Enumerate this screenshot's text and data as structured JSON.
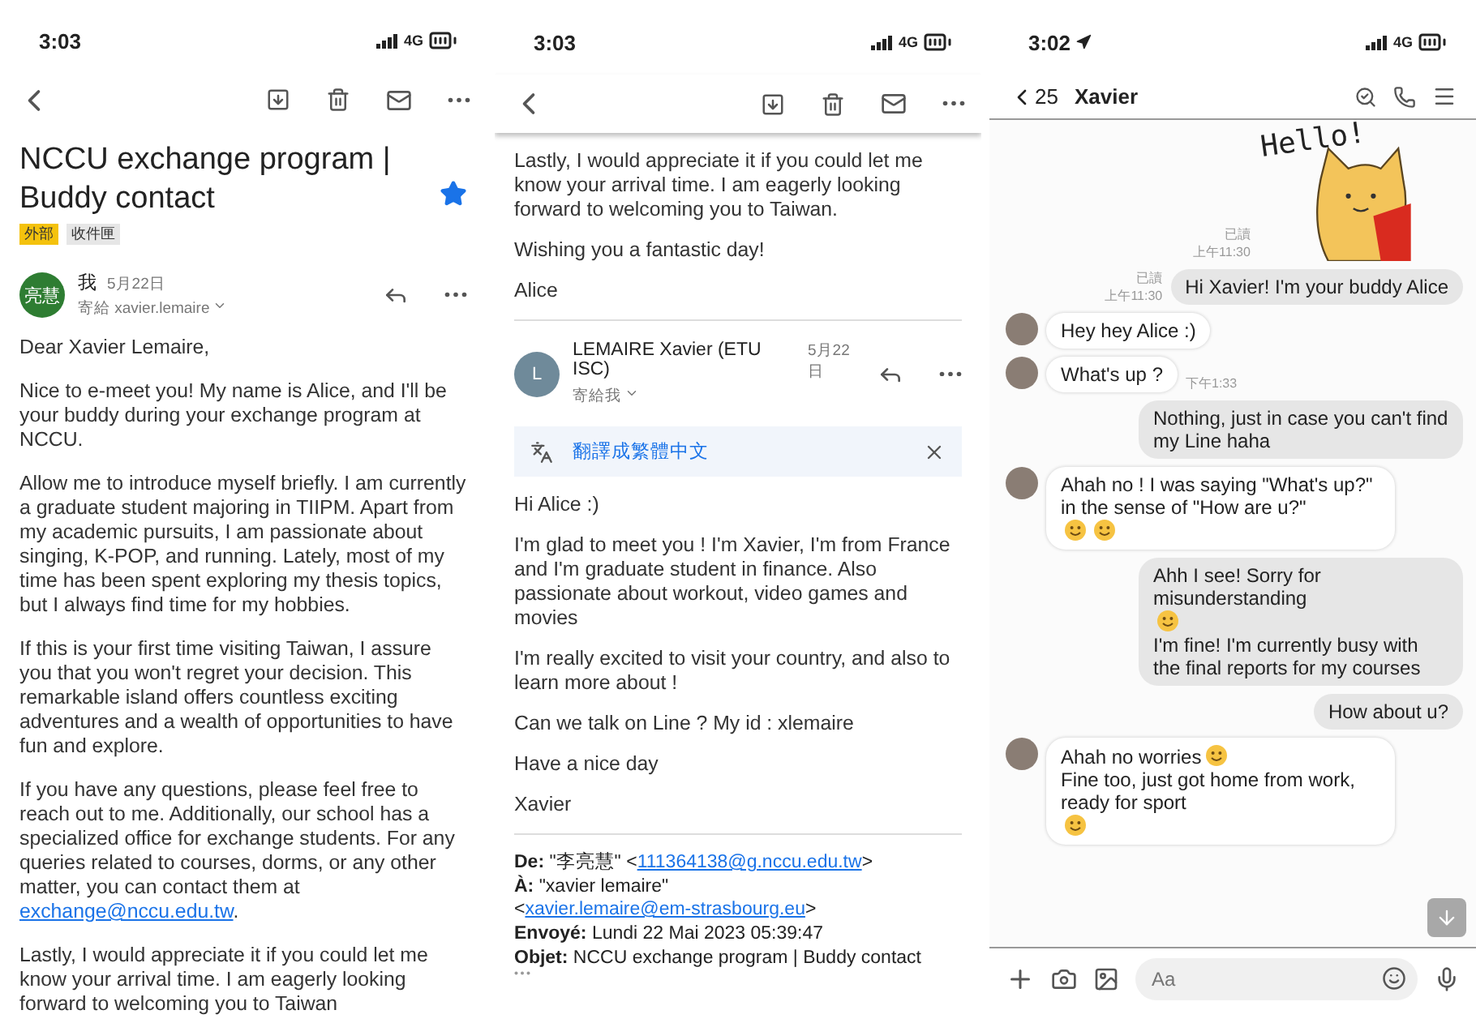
{
  "email_view": {
    "status_bar": {
      "time": "3:03",
      "network": "4G"
    },
    "subject": {
      "title": "NCCU exchange program | Buddy contact",
      "labels": [
        {
          "text": "外部",
          "color": "#f4c20d"
        },
        {
          "text": "收件匣",
          "color": "#e6e6e6"
        }
      ],
      "starred": true
    },
    "message": {
      "avatar_text": "亮慧",
      "sender": "我",
      "date": "5月22日",
      "recipient": "寄給 xavier.lemaire",
      "paragraphs": [
        {
          "text": "Dear Xavier Lemaire,"
        },
        {
          "text": "Nice to e-meet you! My name is Alice, and I'll be your buddy during your exchange program at NCCU."
        },
        {
          "text": "Allow me to introduce myself briefly. I am currently a graduate student majoring in TIIPM. Apart from my academic pursuits, I am passionate about singing, K-POP, and running. Lately, most of my time has been spent exploring my thesis topics, but I always find time for my hobbies."
        },
        {
          "text": "If this is your first time visiting Taiwan, I assure you that you won't regret your decision. This remarkable island offers countless exciting adventures and a wealth of opportunities to have fun and explore."
        },
        {
          "text": "If you have any questions, please feel free to reach out to me. Additionally, our school has a specialized office for exchange students. For any queries related to courses, dorms, or any other matter, you can contact them at ",
          "link": "exchange@nccu.edu.tw",
          "after": "."
        },
        {
          "text": "Lastly, I would appreciate it if you could let me know your arrival time. I am eagerly looking forward to welcoming you to Taiwan"
        }
      ]
    }
  },
  "email_thread": {
    "status_bar": {
      "time": "3:03",
      "network": "4G"
    },
    "earlier_paragraphs": [
      {
        "text": "Lastly, I would appreciate it if you could let me know your arrival time. I am eagerly looking forward to welcoming you to Taiwan."
      },
      {
        "text": "Wishing you a fantastic day!"
      },
      {
        "text": "Alice"
      }
    ],
    "reply": {
      "avatar_text": "L",
      "sender": "LEMAIRE Xavier (ETU ISC)",
      "date": "5月22日",
      "recipient": "寄給我",
      "translate": "翻譯成繁體中文",
      "paragraphs": [
        {
          "text": "Hi Alice :)"
        },
        {
          "text": "I'm glad to meet you ! I'm Xavier, I'm from France and I'm graduate student in finance. Also passionate about workout, video games and movies"
        },
        {
          "text": "I'm really excited to visit your country, and also to learn more about !"
        },
        {
          "text": "Can we talk on Line ? My id : xlemaire"
        },
        {
          "text": "Have a nice day"
        },
        {
          "text": "Xavier"
        }
      ],
      "quoted_header": [
        {
          "label": "De:",
          "text": " \"李亮慧\" <",
          "link": "111364138@g.nccu.edu.tw",
          "after": ">"
        },
        {
          "label": "À:",
          "text": " \"xavier lemaire\" <",
          "link": "xavier.lemaire@em-strasbourg.eu",
          "after": ">"
        },
        {
          "label": "Envoyé:",
          "text": " Lundi 22 Mai 2023 05:39:47"
        },
        {
          "label": "Objet:",
          "text": " NCCU exchange program | Buddy contact"
        }
      ]
    }
  },
  "chat": {
    "status_bar": {
      "time": "3:02",
      "network": "4G"
    },
    "header": {
      "back_count": "25",
      "name": "Xavier"
    },
    "sticker": {
      "text": "Hello!",
      "read": "已讀",
      "time": "上午11:30"
    },
    "messages": [
      {
        "kind": "sent",
        "read": "已讀",
        "time": "上午11:30",
        "parts": [
          {
            "kind": "text",
            "text": "Hi Xavier! I'm your buddy Alice"
          }
        ]
      },
      {
        "kind": "received",
        "parts": [
          {
            "kind": "text",
            "text": "Hey hey Alice :)"
          }
        ]
      },
      {
        "kind": "received",
        "time": "下午1:33",
        "parts": [
          {
            "kind": "text",
            "text": "What's up ?"
          }
        ]
      },
      {
        "kind": "sent",
        "parts": [
          {
            "kind": "text",
            "text": "Nothing, just in case you can't find my Line haha"
          }
        ]
      },
      {
        "kind": "received",
        "parts": [
          {
            "kind": "text",
            "text": "Ahah no ! I was saying \"What's up?\" in the sense of \"How are u?\""
          },
          {
            "kind": "emoji"
          },
          {
            "kind": "emoji"
          }
        ]
      },
      {
        "kind": "sent",
        "parts": [
          {
            "kind": "text",
            "text": "Ahh I see!  Sorry for misunderstanding"
          },
          {
            "kind": "emoji"
          },
          {
            "kind": "break"
          },
          {
            "kind": "text",
            "text": "I'm fine! I'm currently busy with the final reports for my courses"
          }
        ]
      },
      {
        "kind": "sent",
        "parts": [
          {
            "kind": "text",
            "text": "How about u?"
          }
        ]
      },
      {
        "kind": "received",
        "parts": [
          {
            "kind": "text",
            "text": "Ahah no worries"
          },
          {
            "kind": "emoji"
          },
          {
            "kind": "text",
            "text": "Fine too, just got home from work, ready for sport"
          },
          {
            "kind": "emoji"
          }
        ]
      }
    ],
    "input": {
      "placeholder": "Aa"
    }
  }
}
